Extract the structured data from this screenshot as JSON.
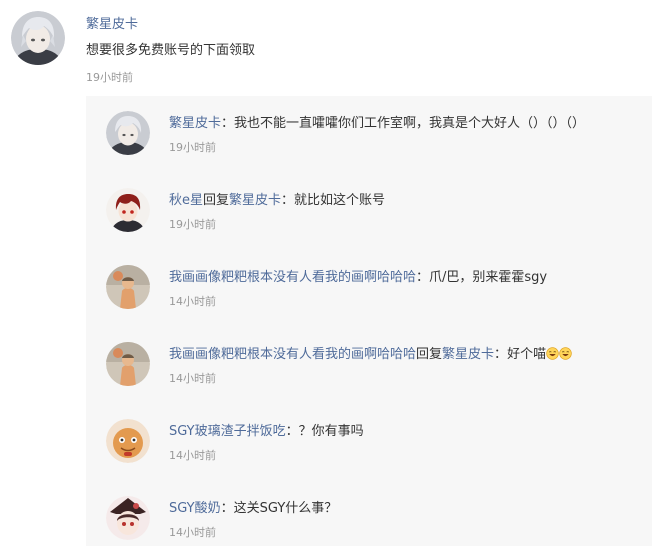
{
  "main": {
    "user": "繁星皮卡",
    "text": "想要很多免费账号的下面领取",
    "time": "19小时前",
    "avatar_icon": "white-haired-anime-avatar"
  },
  "replies": [
    {
      "user": "繁星皮卡",
      "reply_prefix": "",
      "reply_to": "",
      "sep": "：",
      "text": "我也不能一直嚯嚯你们工作室啊，我真是个大好人（）（）（）",
      "time": "19小时前",
      "avatar_icon": "white-haired-anime-avatar"
    },
    {
      "user": "秋e星",
      "reply_prefix": "回复",
      "reply_to": "繁星皮卡",
      "sep": "：",
      "text": "就比如这个账号",
      "time": "19小时前",
      "avatar_icon": "red-eyed-anime-boy-avatar"
    },
    {
      "user": "我画画像粑粑根本没有人看我的画啊哈哈哈",
      "reply_prefix": "",
      "reply_to": "",
      "sep": "：",
      "text": "爪/巴，别来霍霍sgy",
      "time": "14小时前",
      "avatar_icon": "painted-figure-avatar"
    },
    {
      "user": "我画画像粑粑根本没有人看我的画啊哈哈哈",
      "reply_prefix": "回复",
      "reply_to": "繁星皮卡",
      "sep": "：",
      "text": "好个喵",
      "time": "14小时前",
      "avatar_icon": "painted-figure-avatar",
      "emojis": [
        "grin-emoji",
        "grin-emoji"
      ]
    },
    {
      "user": "SGY玻璃渣子拌饭吃",
      "reply_prefix": "",
      "reply_to": "",
      "sep": "：",
      "text": "？你有事吗",
      "time": "14小时前",
      "avatar_icon": "cookie-face-avatar"
    },
    {
      "user": "SGY酸奶",
      "reply_prefix": "",
      "reply_to": "",
      "sep": "：",
      "text": "这关SGY什么事？",
      "time": "14小时前",
      "avatar_icon": "hu-tao-anime-avatar"
    }
  ]
}
